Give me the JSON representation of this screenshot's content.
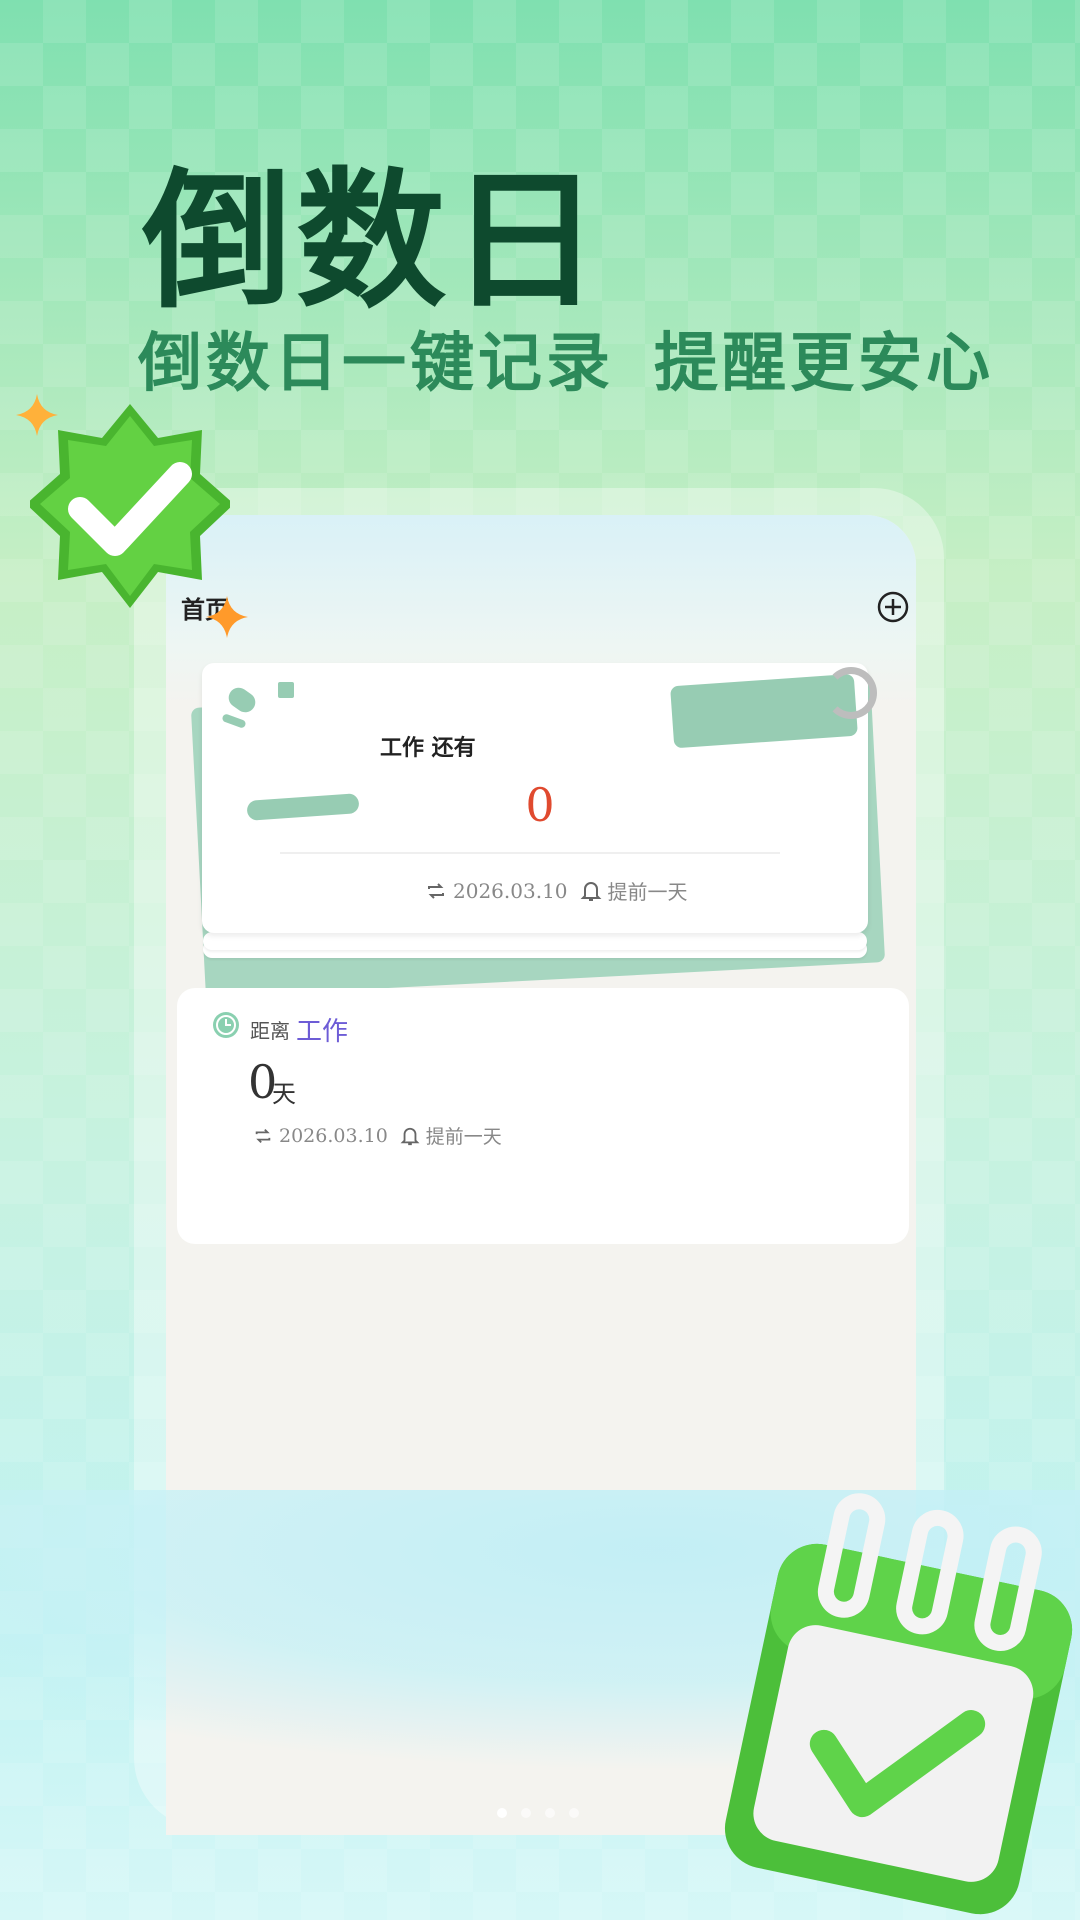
{
  "hero": {
    "title": "倒数日",
    "subtitle_left": "倒数日一键记录",
    "subtitle_right": "提醒更安心"
  },
  "app": {
    "home_title": "首页",
    "add_icon": "plus-circle-icon"
  },
  "featured_card": {
    "title": "工作 还有",
    "count": "0",
    "date": "2026.03.10",
    "reminder": "提前一天",
    "repeat_icon": "repeat-icon",
    "bell_icon": "bell-icon"
  },
  "list_card": {
    "label": "距离",
    "event_name": "工作",
    "days": "0",
    "unit": "天",
    "date": "2026.03.10",
    "reminder": "提前一天",
    "clock_icon": "clock-icon"
  },
  "carousel": {
    "count": 4,
    "active": 0
  },
  "colors": {
    "hero_title": "#0e4a2e",
    "hero_subtitle": "#2c8a5a",
    "count_red": "#e04a2f",
    "event_purple": "#6d5cd6",
    "accent_green": "#4cbf3a",
    "tag_green": "#97ccb3"
  }
}
